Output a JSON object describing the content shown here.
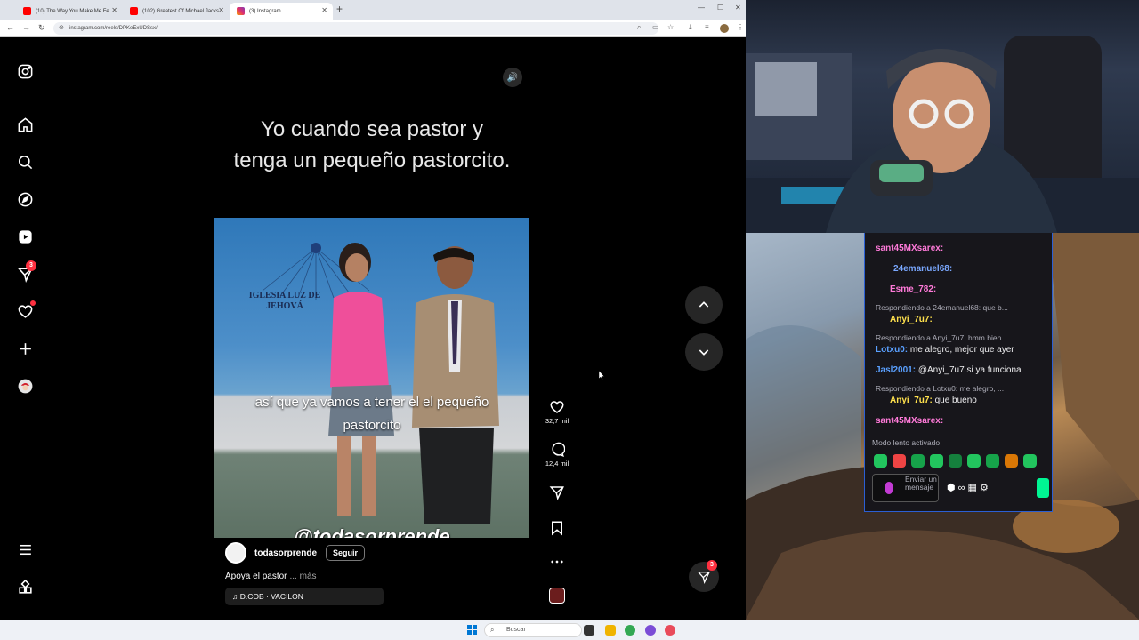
{
  "browser": {
    "tabs": [
      {
        "title": "(10) The Way You Make Me Fe",
        "icon": "youtube-icon",
        "active": false
      },
      {
        "title": "(102) Greatest Of Michael Jacks",
        "icon": "youtube-icon",
        "active": false
      },
      {
        "title": "(3) Instagram",
        "icon": "instagram-icon",
        "active": true
      }
    ],
    "url": "instagram.com/reels/DPKeExUDSsx/"
  },
  "instagram": {
    "nav": {
      "messages_badge": "3"
    },
    "reel": {
      "top_caption": "Yo cuando sea pastor y tenga un pequeño pastorcito.",
      "church_sign": "IGLESIA LUZ DE JEHOVÁ",
      "subtitle": "así que ya vamos a tener el el pequeño pastorcito",
      "watermark": "@todasorprende",
      "author": "todasorprende",
      "follow_label": "Seguir",
      "caption": "Apoya el pastor",
      "more_label": "... más",
      "audio": "D.COB · VACILON"
    },
    "actions": {
      "likes": "32,7 mil",
      "comments": "12,4 mil"
    },
    "fab_badge": "3"
  },
  "chat": {
    "messages": [
      {
        "type": "line",
        "user": "sant45MXsarex:",
        "text": "",
        "color": "#ff7ad9"
      },
      {
        "type": "line",
        "user": "24emanuel68:",
        "text": "",
        "color": "#7aa8ff"
      },
      {
        "type": "line",
        "user": "Esme_782:",
        "text": "",
        "color": "#ff7ad9"
      },
      {
        "type": "reply",
        "text": "Respondiendo a 24emanuel68: que b..."
      },
      {
        "type": "line",
        "user": "Anyi_7u7:",
        "text": "",
        "color": "#ffe14d"
      },
      {
        "type": "reply",
        "text": "Respondiendo a Anyi_7u7: hmm bien ..."
      },
      {
        "type": "line",
        "user": "Lotxu0:",
        "text": " me alegro, mejor que ayer",
        "color": "#5aa0ff"
      },
      {
        "type": "line",
        "user": "Jasl2001:",
        "text": " @Anyi_7u7 si ya funciona",
        "color": "#5aa0ff"
      },
      {
        "type": "reply",
        "text": "Respondiendo a Lotxu0: me alegro, ..."
      },
      {
        "type": "line",
        "user": "Anyi_7u7:",
        "text": " que bueno",
        "color": "#ffe14d"
      },
      {
        "type": "line",
        "user": "sant45MXsarex:",
        "text": "",
        "color": "#ff7ad9"
      }
    ],
    "slow_mode": "Modo lento activado",
    "input_placeholder": "Enviar un mensaje"
  },
  "taskbar": {
    "search_label": "Buscar"
  }
}
